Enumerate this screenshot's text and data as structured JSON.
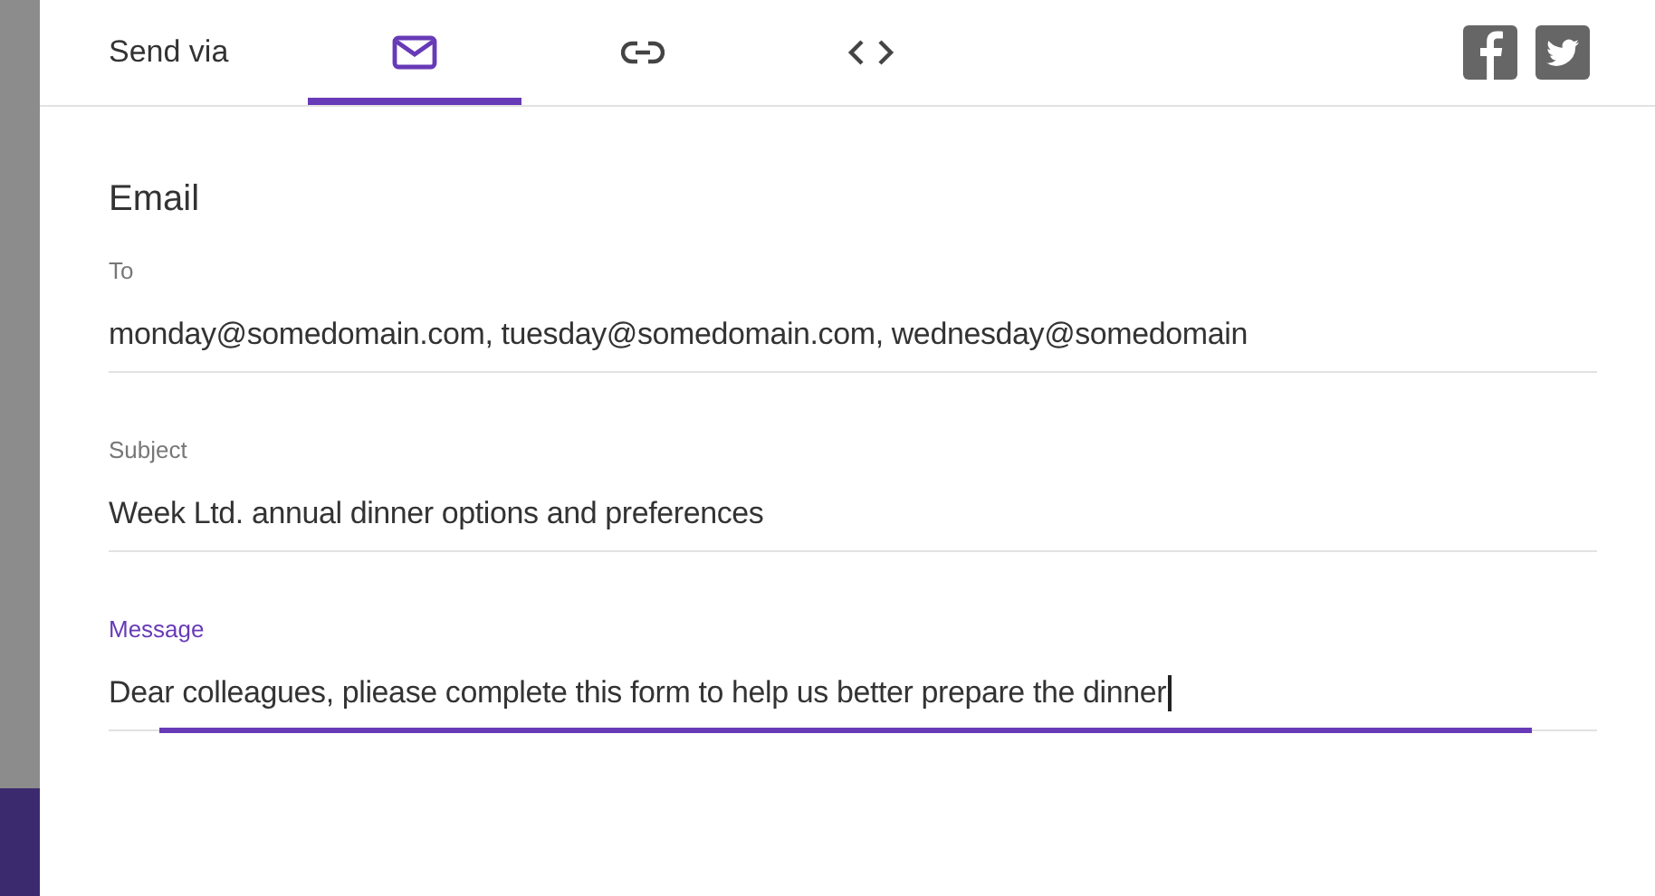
{
  "header": {
    "title": "Send via",
    "tabs": [
      {
        "kind": "email",
        "selected": true
      },
      {
        "kind": "link",
        "selected": false
      },
      {
        "kind": "embed",
        "selected": false
      }
    ],
    "share": [
      {
        "kind": "facebook"
      },
      {
        "kind": "twitter"
      }
    ]
  },
  "section_title": "Email",
  "fields": [
    {
      "label": "To",
      "value": "monday@somedomain.com, tuesday@somedomain.com, wednesday@somedomain",
      "focused": false
    },
    {
      "label": "Subject",
      "value": "Week Ltd. annual dinner options and preferences",
      "focused": false
    },
    {
      "label": "Message",
      "value": "Dear colleagues, pliease complete this form to help us better prepare the dinner",
      "focused": true
    }
  ]
}
